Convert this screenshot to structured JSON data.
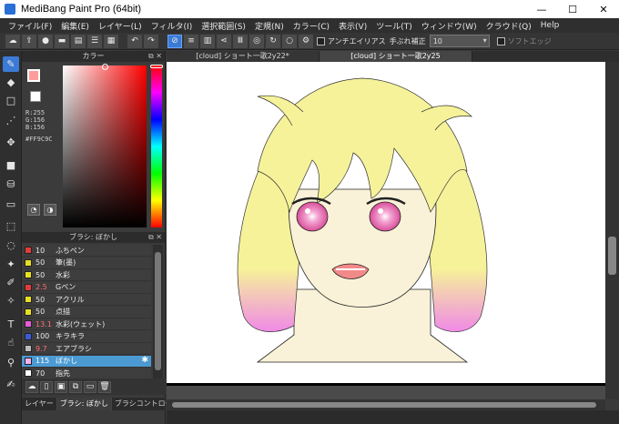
{
  "window": {
    "title": "MediBang Paint Pro (64bit)",
    "minimize": "—",
    "maximize": "☐",
    "close": "✕"
  },
  "menu": [
    "ファイル(F)",
    "編集(E)",
    "レイヤー(L)",
    "フィルタ(I)",
    "選択範囲(S)",
    "定規(N)",
    "カラー(C)",
    "表示(V)",
    "ツール(T)",
    "ウィンドウ(W)",
    "クラウド(Q)",
    "Help"
  ],
  "toolbar": {
    "antialias_label": "アンチエイリアス",
    "stabilizer_label": "手ぶれ補正",
    "stabilizer_value": "10",
    "soft_edge_label": "ソフトエッジ"
  },
  "color_panel": {
    "title": "カラー",
    "r": "R:255",
    "g": "G:156",
    "b": "B:156",
    "hex": "#FF9C9C",
    "foreground": "#ff9c9c",
    "background": "#ffffff"
  },
  "brush_panel": {
    "title": "ブラシ: ぼかし",
    "brushes": [
      {
        "size": "10",
        "name": "ふちペン",
        "color": "#e23b3b",
        "red": false
      },
      {
        "size": "50",
        "name": "筆(墨)",
        "color": "#e8e020",
        "red": false
      },
      {
        "size": "50",
        "name": "水彩",
        "color": "#e8e020",
        "red": false
      },
      {
        "size": "2.5",
        "name": "Gペン",
        "color": "#e23b3b",
        "red": true
      },
      {
        "size": "50",
        "name": "アクリル",
        "color": "#e8e020",
        "red": false
      },
      {
        "size": "50",
        "name": "点描",
        "color": "#e8e020",
        "red": false
      },
      {
        "size": "13.1",
        "name": "水彩(ウェット)",
        "color": "#e85bd8",
        "red": true
      },
      {
        "size": "100",
        "name": "キラキラ",
        "color": "#3b5bd6",
        "red": false
      },
      {
        "size": "9.7",
        "name": "エアブラシ",
        "color": "#bbbbbb",
        "red": true
      },
      {
        "size": "115",
        "name": "ぼかし",
        "color": "#f4b2f0",
        "red": true,
        "selected": true
      },
      {
        "size": "70",
        "name": "指先",
        "color": "#ffffff",
        "red": false
      }
    ]
  },
  "bottom_tabs": [
    "レイヤー",
    "ブラシ: ぼかし",
    "ブラシコントロール"
  ],
  "doc_tabs": [
    "[cloud] ショート一歌2y22*",
    "[cloud] ショート一歌2y25"
  ],
  "drawing": {
    "hair_color": "#f6f29a",
    "hair_tip_color": "#f08ae6",
    "skin_color": "#faf2d8",
    "eye_color": "#e86ba6"
  }
}
